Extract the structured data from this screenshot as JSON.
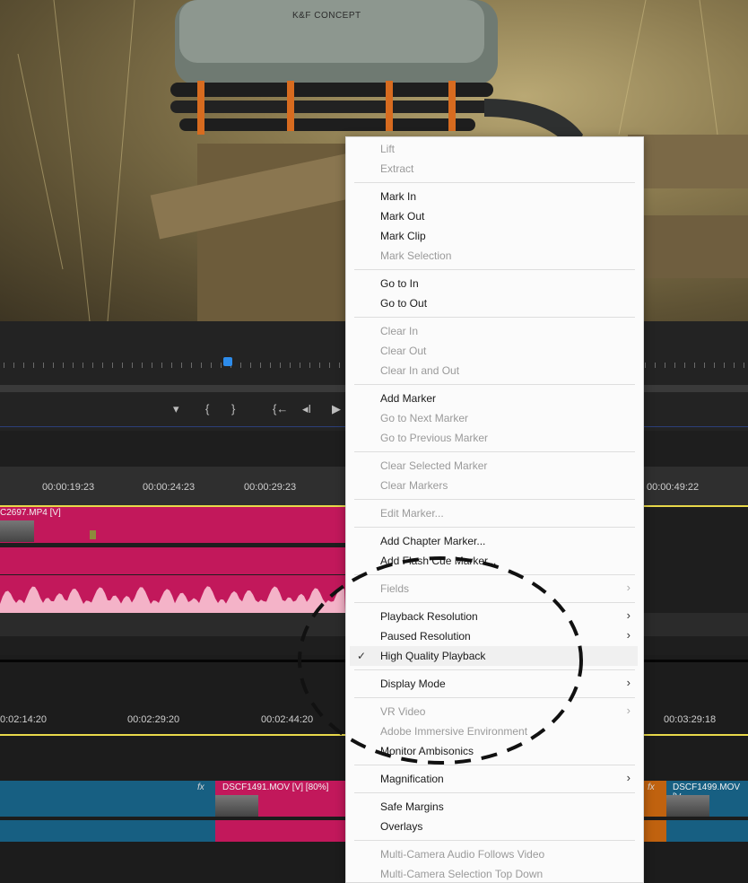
{
  "preview": {
    "bag_brand": "K&F CONCEPT"
  },
  "controls": {
    "marker_icon": "marker-icon",
    "mark_in_icon": "mark-in-icon",
    "mark_out_icon": "mark-out-icon",
    "go_to_in_icon": "go-to-in-icon",
    "step_back_icon": "step-back-icon",
    "play_icon": "play-icon"
  },
  "timeline_upper": {
    "timecodes": [
      "00:00:19:23",
      "00:00:24:23",
      "00:00:29:23",
      "00:00:49:22"
    ],
    "video_clip_title": "C2697.MP4 [V]"
  },
  "timeline_lower": {
    "timecodes": [
      "0:02:14:20",
      "00:02:29:20",
      "00:02:44:20",
      "00:03:29:18"
    ],
    "clips": [
      {
        "title": "DSCF1491.MOV [V] [80%]"
      },
      {
        "title": "DSCF1499.MOV [V"
      }
    ],
    "fx_label": "fx"
  },
  "context_menu": {
    "items": [
      {
        "label": "Lift",
        "enabled": false
      },
      {
        "label": "Extract",
        "enabled": false
      },
      {
        "label": "Mark In",
        "enabled": true
      },
      {
        "label": "Mark Out",
        "enabled": true
      },
      {
        "label": "Mark Clip",
        "enabled": true
      },
      {
        "label": "Mark Selection",
        "enabled": false
      },
      {
        "label": "Go to In",
        "enabled": true
      },
      {
        "label": "Go to Out",
        "enabled": true
      },
      {
        "label": "Clear In",
        "enabled": false
      },
      {
        "label": "Clear Out",
        "enabled": false
      },
      {
        "label": "Clear In and Out",
        "enabled": false
      },
      {
        "label": "Add Marker",
        "enabled": true
      },
      {
        "label": "Go to Next Marker",
        "enabled": false
      },
      {
        "label": "Go to Previous Marker",
        "enabled": false
      },
      {
        "label": "Clear Selected Marker",
        "enabled": false
      },
      {
        "label": "Clear Markers",
        "enabled": false
      },
      {
        "label": "Edit Marker...",
        "enabled": false
      },
      {
        "label": "Add Chapter Marker...",
        "enabled": true
      },
      {
        "label": "Add Flash Cue Marker...",
        "enabled": true
      },
      {
        "label": "Fields",
        "enabled": false,
        "submenu": true
      },
      {
        "label": "Playback Resolution",
        "enabled": true,
        "submenu": true
      },
      {
        "label": "Paused Resolution",
        "enabled": true,
        "submenu": true
      },
      {
        "label": "High Quality Playback",
        "enabled": true,
        "checked": true
      },
      {
        "label": "Display Mode",
        "enabled": true,
        "submenu": true
      },
      {
        "label": "VR Video",
        "enabled": false,
        "submenu": true
      },
      {
        "label": "Adobe Immersive Environment",
        "enabled": false
      },
      {
        "label": "Monitor Ambisonics",
        "enabled": true
      },
      {
        "label": "Magnification",
        "enabled": true,
        "submenu": true
      },
      {
        "label": "Safe Margins",
        "enabled": true
      },
      {
        "label": "Overlays",
        "enabled": true
      },
      {
        "label": "Multi-Camera Audio Follows Video",
        "enabled": false
      },
      {
        "label": "Multi-Camera Selection Top Down",
        "enabled": false
      }
    ],
    "check_glyph": "✓",
    "submenu_glyph": "›"
  },
  "colors": {
    "clip_red": "#c2185b",
    "clip_blue": "#175f82",
    "clip_orange": "#c0620f",
    "playhead": "#2d8ceb",
    "timeline_yellow": "#e8d84a"
  }
}
